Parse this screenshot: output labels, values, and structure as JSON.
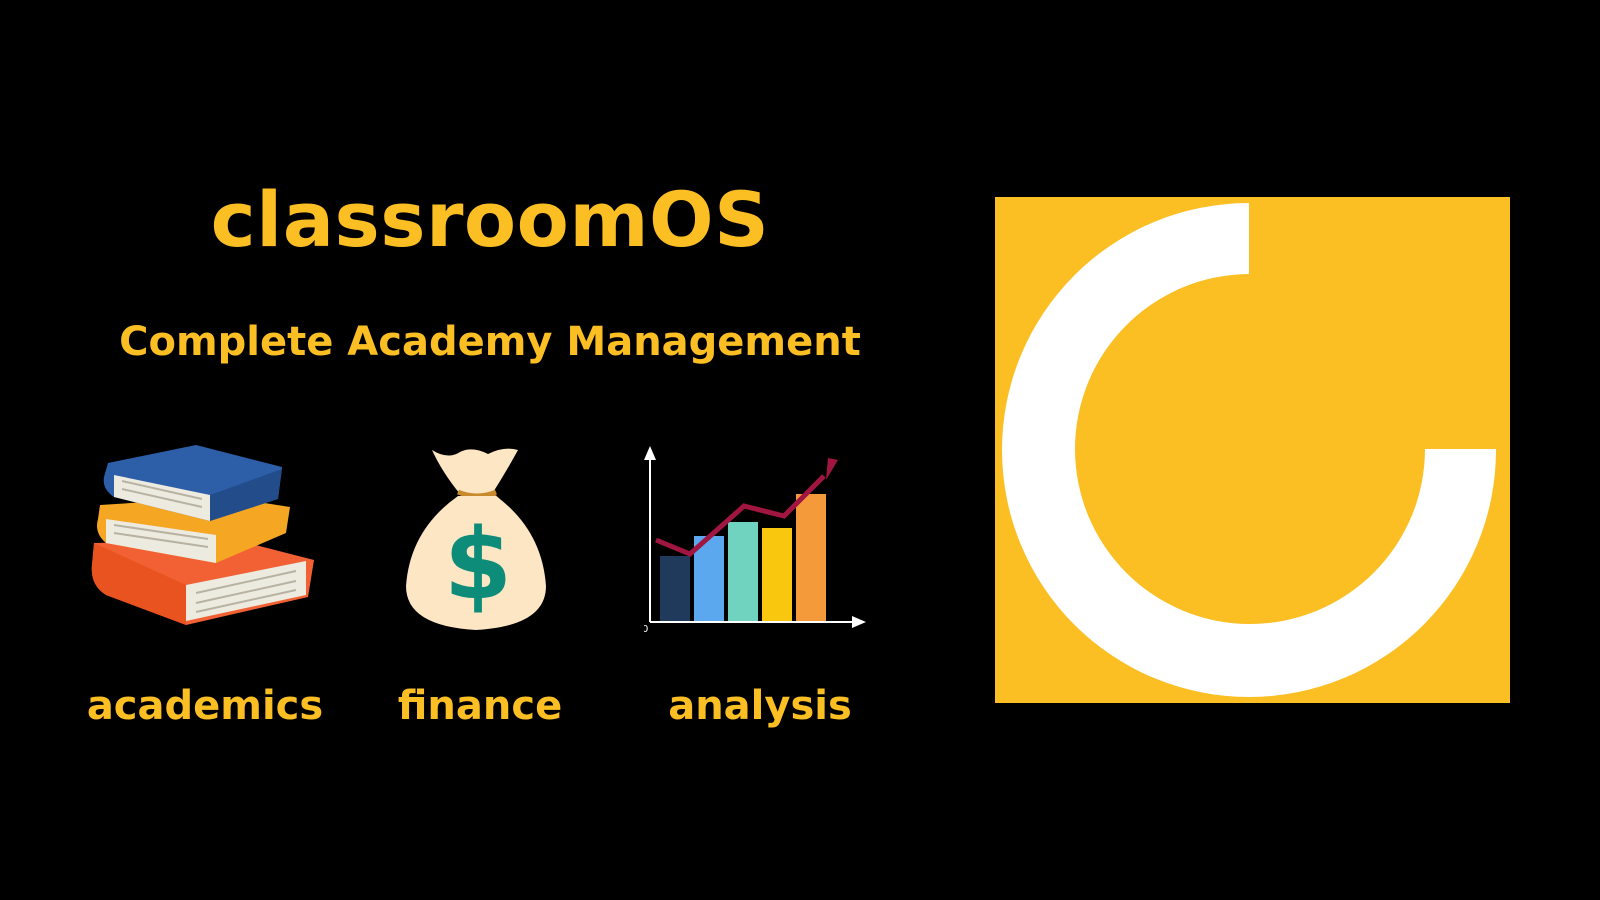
{
  "title": "classroomOS",
  "subtitle": "Complete Academy Management",
  "features": [
    {
      "label": "academics",
      "icon": "books-stack-icon"
    },
    {
      "label": "finance",
      "icon": "money-bag-icon"
    },
    {
      "label": "analysis",
      "icon": "growth-chart-icon"
    }
  ],
  "chart_icon": {
    "origin_label": "0"
  },
  "money_symbol": "$",
  "colors": {
    "background": "#000000",
    "accent": "#FBBF24",
    "logo_ring": "#FFFFFF"
  }
}
